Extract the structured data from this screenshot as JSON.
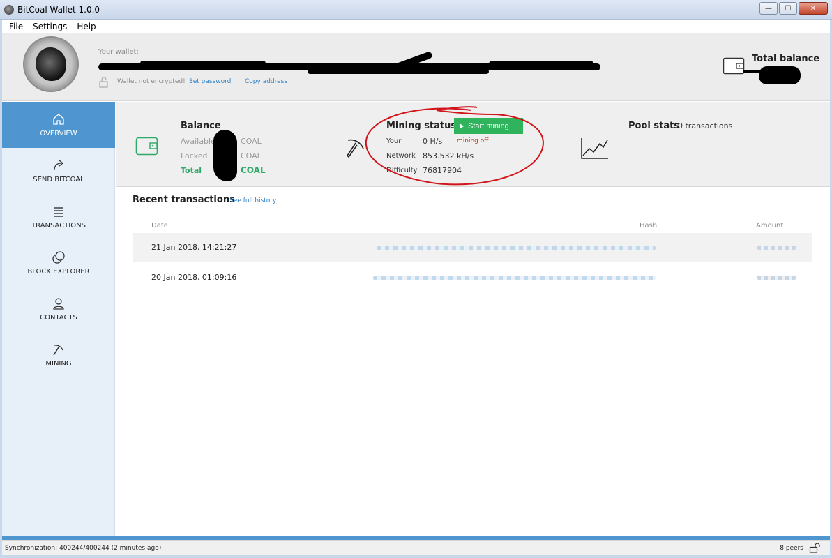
{
  "window": {
    "title": "BitCoal Wallet 1.0.0",
    "controls": {
      "minimize": "—",
      "maximize": "☐",
      "close": "✕"
    }
  },
  "menu": [
    "File",
    "Settings",
    "Help"
  ],
  "header": {
    "wallet_label": "Your wallet:",
    "not_encrypted": "Wallet not encrypted!",
    "set_password": "Set password",
    "copy_address": "Copy address",
    "total_balance_label": "Total balance"
  },
  "sidebar": {
    "items": [
      {
        "label": "OVERVIEW",
        "icon": "home-icon",
        "active": true
      },
      {
        "label": "SEND BITCOAL",
        "icon": "send-arrow-icon",
        "active": false
      },
      {
        "label": "TRANSACTIONS",
        "icon": "list-icon",
        "active": false
      },
      {
        "label": "BLOCK EXPLORER",
        "icon": "coins-icon",
        "active": false
      },
      {
        "label": "CONTACTS",
        "icon": "user-icon",
        "active": false
      },
      {
        "label": "MINING",
        "icon": "pickaxe-icon",
        "active": false
      }
    ]
  },
  "balance": {
    "title": "Balance",
    "available_label": "Available",
    "locked_label": "Locked",
    "total_label": "Total",
    "unit": "COAL"
  },
  "mining": {
    "title": "Mining status",
    "start_button": "Start mining",
    "your_label": "Your",
    "your_value": "0 H/s",
    "state": "mining off",
    "network_label": "Network",
    "network_value": "853.532 kH/s",
    "difficulty_label": "Difficulty",
    "difficulty_value": "76817904"
  },
  "pool": {
    "title": "Pool stats",
    "transactions": "0 transactions"
  },
  "transactions": {
    "title": "Recent transactions",
    "see_history": "See full history",
    "columns": {
      "date": "Date",
      "hash": "Hash",
      "amount": "Amount"
    },
    "rows": [
      {
        "date": "21 Jan 2018, 14:21:27"
      },
      {
        "date": "20 Jan 2018, 01:09:16"
      }
    ]
  },
  "status": {
    "sync": "Synchronization: 400244/400244 (2 minutes ago)",
    "peers": "8 peers"
  },
  "colors": {
    "accent": "#4f95cf",
    "green": "#2fb35c",
    "link": "#2f7fc4",
    "annotation_red": "#d0141a"
  }
}
